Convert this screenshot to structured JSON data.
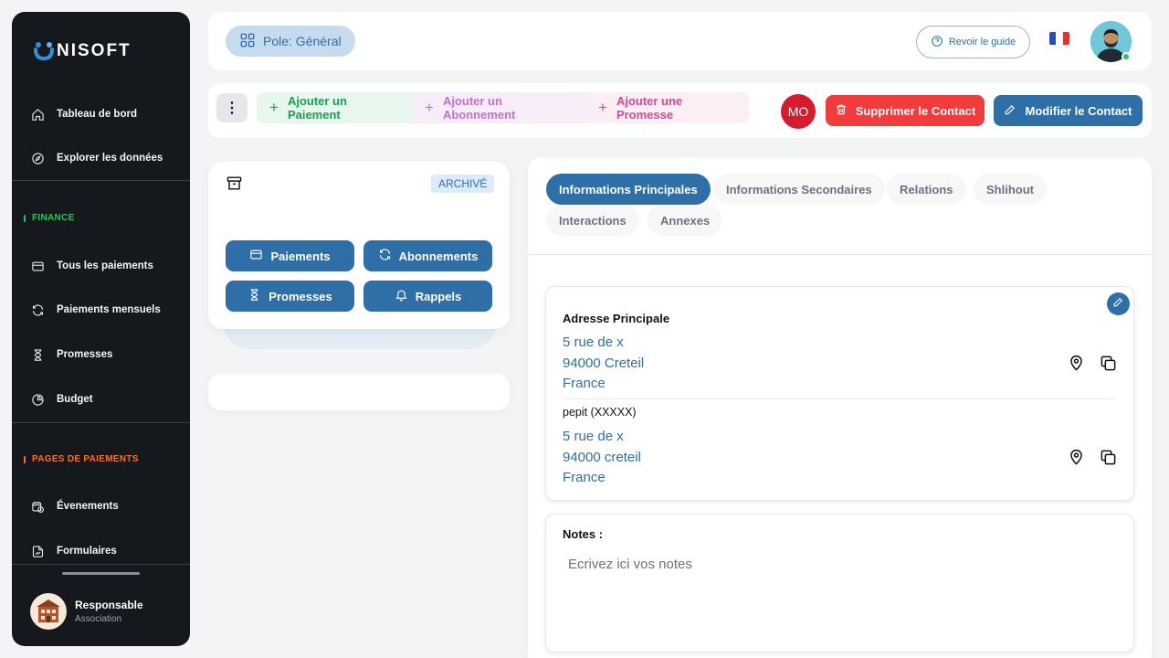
{
  "brand": {
    "name": "NISOFT",
    "logo_icon": "unisoft-logo"
  },
  "sidebar": {
    "items_top": [
      {
        "label": "Tableau de bord",
        "icon": "home-icon"
      },
      {
        "label": "Explorer les données",
        "icon": "compass-icon"
      }
    ],
    "section_finance": {
      "label": "FINANCE",
      "color": "#22c55e"
    },
    "items_finance": [
      {
        "label": "Tous les paiements",
        "icon": "credit-card-icon"
      },
      {
        "label": "Paiements mensuels",
        "icon": "refresh-icon"
      },
      {
        "label": "Promesses",
        "icon": "hourglass-icon"
      },
      {
        "label": "Budget",
        "icon": "pie-chart-icon"
      }
    ],
    "section_pages": {
      "label": "PAGES DE PAIEMENTS",
      "color": "#f97316"
    },
    "items_pages": [
      {
        "label": "Évenements",
        "icon": "calendar-clock-icon"
      },
      {
        "label": "Formulaires",
        "icon": "form-icon"
      }
    ],
    "profile": {
      "name": "Responsable",
      "role": "Association"
    }
  },
  "header": {
    "pole_label": "Pole: Général",
    "guide_label": "Revoir le guide",
    "flag_colors": [
      "#1f4fbf",
      "#ffffff",
      "#e5322d"
    ]
  },
  "actions": {
    "add_payment": {
      "label": "Ajouter un Paiement",
      "color": "#16a34a",
      "bg": "#e8f7ee"
    },
    "add_subscription": {
      "label": "Ajouter un Abonnement",
      "color": "#c66fd6",
      "bg": "#f7edf9"
    },
    "add_promise": {
      "label": "Ajouter une Promesse",
      "color": "#e0468c",
      "bg": "#fbeef4"
    },
    "initials": "MO",
    "delete_label": "Supprimer le Contact",
    "edit_label": "Modifier le Contact"
  },
  "contact_card": {
    "badge": "ARCHIVÉ",
    "buttons": [
      {
        "label": "Paiements",
        "icon": "credit-card-icon"
      },
      {
        "label": "Abonnements",
        "icon": "refresh-icon"
      },
      {
        "label": "Promesses",
        "icon": "hourglass-icon"
      },
      {
        "label": "Rappels",
        "icon": "bell-icon"
      }
    ]
  },
  "tabs": [
    {
      "label": "Informations Principales",
      "active": true
    },
    {
      "label": "Informations Secondaires",
      "active": false
    },
    {
      "label": "Relations",
      "active": false
    },
    {
      "label": "Shlihout",
      "active": false
    },
    {
      "label": "Interactions",
      "active": false
    },
    {
      "label": "Annexes",
      "active": false
    }
  ],
  "addresses": {
    "primary": {
      "title": "Adresse Principale",
      "line1": "5 rue de x",
      "line2": "94000 Creteil",
      "line3": "France"
    },
    "secondary": {
      "title": "pepit (XXXXX)",
      "line1": "5 rue de x",
      "line2": "94000 creteil",
      "line3": "France"
    }
  },
  "notes": {
    "title": "Notes :",
    "placeholder": "Ecrivez ici vos notes"
  }
}
